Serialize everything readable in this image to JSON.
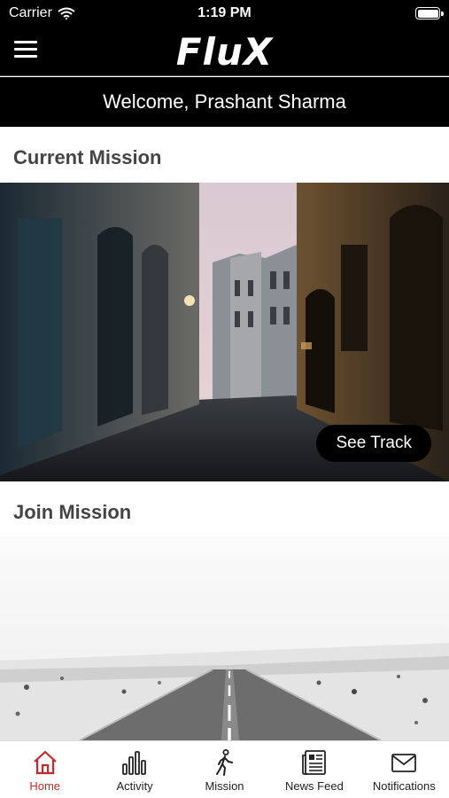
{
  "status_bar": {
    "carrier": "Carrier",
    "time": "1:19 PM"
  },
  "header": {
    "logo": "FluX"
  },
  "welcome": {
    "text": "Welcome, Prashant Sharma"
  },
  "current_mission": {
    "title": "Current Mission",
    "button_label": "See Track"
  },
  "join_mission": {
    "title": "Join Mission"
  },
  "tabs": [
    {
      "label": "Home",
      "icon": "home-icon",
      "active": true
    },
    {
      "label": "Activity",
      "icon": "activity-icon"
    },
    {
      "label": "Mission",
      "icon": "mission-walker-icon"
    },
    {
      "label": "News Feed",
      "icon": "news-feed-icon"
    },
    {
      "label": "Notifications",
      "icon": "notifications-mail-icon"
    }
  ],
  "colors": {
    "active_tab": "#c62828",
    "header_bg": "#000000"
  }
}
